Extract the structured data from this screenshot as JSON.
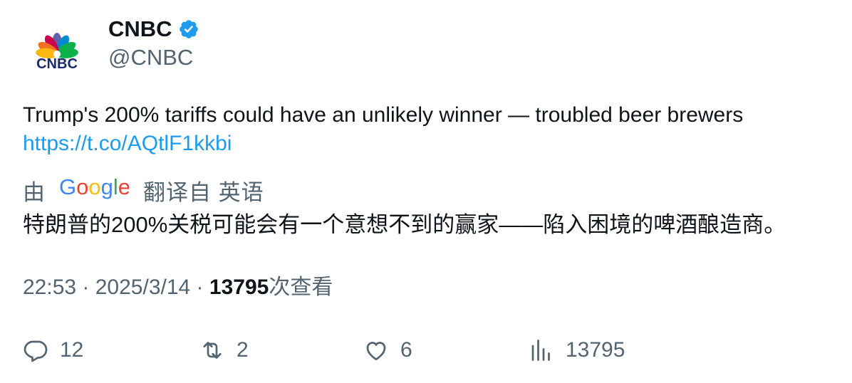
{
  "author": {
    "name": "CNBC",
    "handle": "@CNBC",
    "avatar_logo_text": "CNBC",
    "verified": true
  },
  "tweet": {
    "text": "Trump's 200% tariffs could have an unlikely winner — troubled beer brewers",
    "link": "https://t.co/AQtlF1kkbi"
  },
  "translation": {
    "by_label": "由",
    "provider": "Google",
    "from_label": "翻译自 英语",
    "text": "特朗普的200%关税可能会有一个意想不到的赢家——陷入困境的啤酒酿造商。"
  },
  "meta": {
    "time": "22:53",
    "sep1": " · ",
    "date": "2025/3/14",
    "sep2": " · ",
    "views": "13795",
    "views_label": "次查看"
  },
  "actions": {
    "replies": "12",
    "retweets": "2",
    "likes": "6",
    "views": "13795"
  },
  "colors": {
    "text": "#0f1419",
    "secondary": "#536471",
    "link": "#1d9bf0",
    "verified": "#1d9bf0"
  }
}
